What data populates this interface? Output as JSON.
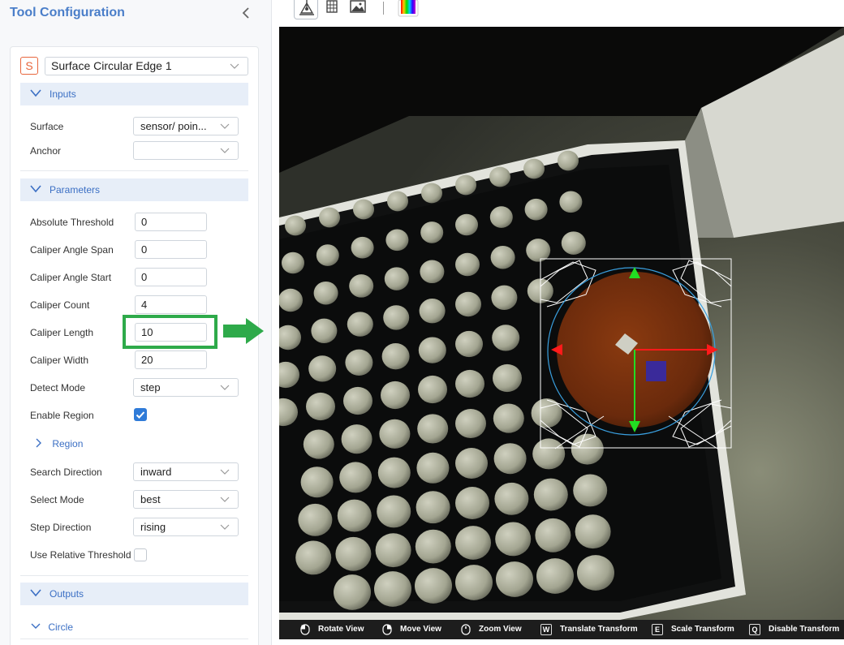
{
  "panel": {
    "title": "Tool Configuration",
    "tool_badge": "S",
    "tool_name": "Surface Circular Edge 1"
  },
  "sections": {
    "inputs": "Inputs",
    "parameters": "Parameters",
    "outputs": "Outputs"
  },
  "inputs": {
    "surface_label": "Surface",
    "surface_value": "sensor/ poin...",
    "anchor_label": "Anchor",
    "anchor_value": ""
  },
  "parameters": {
    "absolute_threshold_label": "Absolute Threshold",
    "absolute_threshold_value": "0",
    "caliper_angle_span_label": "Caliper Angle Span",
    "caliper_angle_span_value": "0",
    "caliper_angle_start_label": "Caliper Angle Start",
    "caliper_angle_start_value": "0",
    "caliper_count_label": "Caliper Count",
    "caliper_count_value": "4",
    "caliper_length_label": "Caliper Length",
    "caliper_length_value": "10",
    "caliper_width_label": "Caliper Width",
    "caliper_width_value": "20",
    "detect_mode_label": "Detect Mode",
    "detect_mode_value": "step",
    "enable_region_label": "Enable Region",
    "enable_region_checked": true,
    "region_label": "Region",
    "search_direction_label": "Search Direction",
    "search_direction_value": "inward",
    "select_mode_label": "Select Mode",
    "select_mode_value": "best",
    "step_direction_label": "Step Direction",
    "step_direction_value": "rising",
    "use_relative_threshold_label": "Use Relative Threshold",
    "use_relative_threshold_checked": false
  },
  "outputs": {
    "circle_label": "Circle"
  },
  "toolbar": {
    "icons": [
      "transform-gizmo-icon",
      "grid-icon",
      "image-icon",
      "color-spectrum-icon"
    ]
  },
  "statusbar": {
    "rotate_view": "Rotate View",
    "move_view": "Move View",
    "zoom_view": "Zoom View",
    "translate_key": "W",
    "translate_transform": "Translate Transform",
    "scale_key": "E",
    "scale_transform": "Scale Transform",
    "disable_key": "Q",
    "disable_transform": "Disable Transform"
  },
  "colors": {
    "accent": "#3b6fc4",
    "title": "#4a7ec9",
    "highlight": "#2eaa4a",
    "checkbox": "#2f7bd8",
    "gizmo_x": "#ff1a1a",
    "gizmo_y": "#22dd22",
    "gizmo_circle": "#3aa0e0"
  }
}
